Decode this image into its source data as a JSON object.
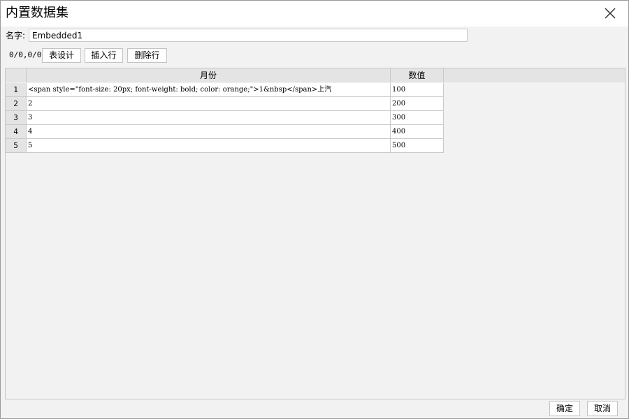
{
  "dialog": {
    "title": "内置数据集",
    "name_label": "名字:",
    "name_value": "Embedded1",
    "position_text": "0/0,0/0"
  },
  "toolbar": {
    "table_design": "表设计",
    "insert_row": "插入行",
    "delete_row": "删除行"
  },
  "table": {
    "columns": [
      "月份",
      "数值"
    ],
    "rows": [
      {
        "index": "1",
        "month": "<span style=\"font-size: 20px; font-weight: bold; color: orange;\">1&nbsp</span>上汽",
        "value": "100"
      },
      {
        "index": "2",
        "month": "2",
        "value": "200"
      },
      {
        "index": "3",
        "month": "3",
        "value": "300"
      },
      {
        "index": "4",
        "month": "4",
        "value": "400"
      },
      {
        "index": "5",
        "month": "5",
        "value": "500"
      }
    ]
  },
  "footer": {
    "ok": "确定",
    "cancel": "取消"
  },
  "icons": {
    "close": "close-icon"
  }
}
